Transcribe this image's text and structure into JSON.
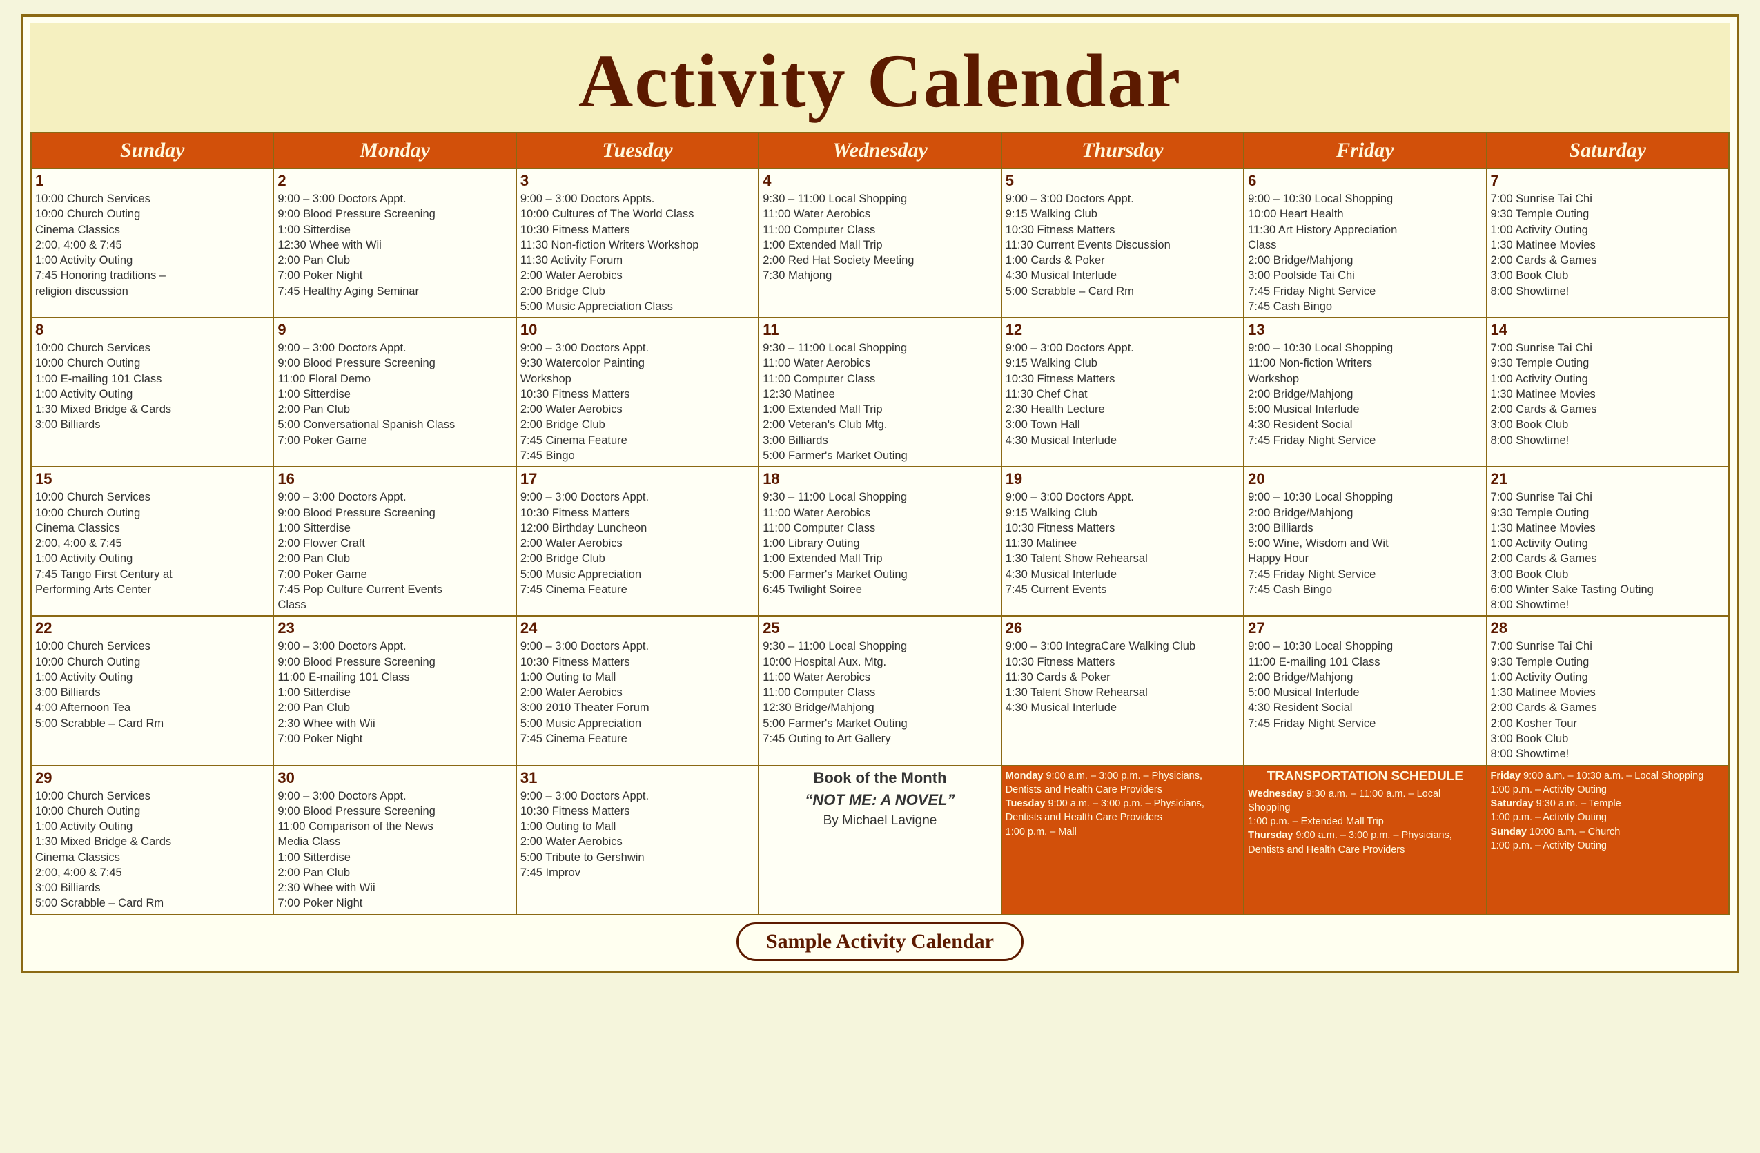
{
  "header": {
    "title": "Activity Calendar"
  },
  "days": [
    "Sunday",
    "Monday",
    "Tuesday",
    "Wednesday",
    "Thursday",
    "Friday",
    "Saturday"
  ],
  "weeks": [
    {
      "cells": [
        {
          "num": "1",
          "events": [
            "10:00 Church Services",
            "10:00 Church Outing",
            "Cinema Classics",
            "2:00, 4:00 & 7:45",
            "1:00  Activity Outing",
            "7:45 Honoring traditions –",
            "religion discussion"
          ]
        },
        {
          "num": "2",
          "events": [
            "9:00 – 3:00 Doctors Appt.",
            "9:00 Blood Pressure Screening",
            "1:00 Sitterdise",
            "12:30 Whee with Wii",
            "2:00 Pan Club",
            "7:00 Poker Night",
            "7:45 Healthy Aging Seminar"
          ]
        },
        {
          "num": "3",
          "events": [
            "9:00 – 3:00 Doctors Appts.",
            "10:00 Cultures of The World Class",
            "10:30 Fitness Matters",
            "11:30 Non-fiction Writers Workshop",
            "11:30 Activity Forum",
            "2:00 Water Aerobics",
            "2:00 Bridge Club",
            "5:00 Music Appreciation Class"
          ]
        },
        {
          "num": "4",
          "events": [
            "9:30 – 11:00 Local Shopping",
            "11:00 Water Aerobics",
            "11:00 Computer Class",
            "1:00 Extended Mall Trip",
            "2:00 Red Hat Society Meeting",
            "7:30 Mahjong"
          ]
        },
        {
          "num": "5",
          "events": [
            "9:00 – 3:00 Doctors Appt.",
            "9:15 Walking Club",
            "10:30 Fitness Matters",
            "11:30 Current Events Discussion",
            "1:00 Cards & Poker",
            "4:30 Musical Interlude",
            "5:00 Scrabble – Card Rm"
          ]
        },
        {
          "num": "6",
          "events": [
            "9:00 – 10:30 Local Shopping",
            "10:00 Heart Health",
            "11:30 Art History Appreciation",
            "Class",
            "2:00 Bridge/Mahjong",
            "3:00 Poolside Tai Chi",
            "7:45 Friday Night Service",
            "7:45 Cash Bingo"
          ]
        },
        {
          "num": "7",
          "events": [
            "7:00 Sunrise Tai Chi",
            "9:30 Temple Outing",
            "1:00  Activity Outing",
            "1:30 Matinee Movies",
            "2:00 Cards & Games",
            "3:00 Book Club",
            "8:00 Showtime!"
          ]
        }
      ]
    },
    {
      "cells": [
        {
          "num": "8",
          "events": [
            "10:00 Church Services",
            "10:00 Church Outing",
            "1:00 E-mailing 101 Class",
            "1:00  Activity Outing",
            "1:30 Mixed Bridge & Cards",
            "3:00 Billiards"
          ]
        },
        {
          "num": "9",
          "events": [
            "9:00 – 3:00 Doctors Appt.",
            "9:00 Blood Pressure Screening",
            "11:00 Floral Demo",
            "1:00 Sitterdise",
            "2:00 Pan Club",
            "5:00 Conversational Spanish Class",
            "7:00 Poker Game"
          ]
        },
        {
          "num": "10",
          "events": [
            "9:00 – 3:00 Doctors Appt.",
            "9:30 Watercolor Painting",
            "Workshop",
            "10:30 Fitness Matters",
            "2:00 Water Aerobics",
            "2:00 Bridge Club",
            "7:45 Cinema Feature",
            "7:45 Bingo"
          ]
        },
        {
          "num": "11",
          "events": [
            "9:30 – 11:00 Local Shopping",
            "11:00 Water Aerobics",
            "11:00 Computer Class",
            "12:30 Matinee",
            "1:00 Extended Mall Trip",
            "2:00 Veteran's Club Mtg.",
            "3:00 Billiards",
            "5:00 Farmer's Market Outing"
          ]
        },
        {
          "num": "12",
          "events": [
            "9:00 – 3:00 Doctors Appt.",
            "9:15 Walking Club",
            "10:30 Fitness Matters",
            "11:30 Chef Chat",
            "2:30 Health Lecture",
            "3:00 Town Hall",
            "4:30 Musical Interlude"
          ]
        },
        {
          "num": "13",
          "events": [
            "9:00 – 10:30 Local Shopping",
            "11:00 Non-fiction Writers",
            "Workshop",
            "2:00 Bridge/Mahjong",
            "5:00 Musical Interlude",
            "4:30 Resident Social",
            "7:45 Friday Night Service"
          ]
        },
        {
          "num": "14",
          "events": [
            "7:00 Sunrise Tai Chi",
            "9:30 Temple Outing",
            "1:00  Activity Outing",
            "1:30 Matinee Movies",
            "2:00 Cards & Games",
            "3:00 Book Club",
            "8:00 Showtime!"
          ]
        }
      ]
    },
    {
      "cells": [
        {
          "num": "15",
          "events": [
            "10:00 Church Services",
            "10:00 Church Outing",
            "Cinema Classics",
            "2:00, 4:00 & 7:45",
            "1:00  Activity Outing",
            "7:45 Tango First Century at",
            "Performing Arts Center"
          ]
        },
        {
          "num": "16",
          "events": [
            "9:00 – 3:00 Doctors Appt.",
            "9:00 Blood Pressure Screening",
            "1:00 Sitterdise",
            "2:00 Flower Craft",
            "2:00 Pan Club",
            "7:00 Poker Game",
            "7:45 Pop Culture Current Events",
            "Class"
          ]
        },
        {
          "num": "17",
          "events": [
            "9:00 – 3:00 Doctors Appt.",
            "10:30 Fitness Matters",
            "12:00 Birthday Luncheon",
            "2:00 Water Aerobics",
            "2:00 Bridge Club",
            "5:00 Music Appreciation",
            "7:45 Cinema Feature"
          ]
        },
        {
          "num": "18",
          "events": [
            "9:30 – 11:00 Local Shopping",
            "11:00 Water Aerobics",
            "11:00 Computer Class",
            "1:00 Library Outing",
            "1:00 Extended Mall Trip",
            "5:00 Farmer's Market Outing",
            "6:45 Twilight Soiree"
          ]
        },
        {
          "num": "19",
          "events": [
            "9:00 – 3:00 Doctors Appt.",
            "9:15 Walking Club",
            "10:30 Fitness Matters",
            "11:30 Matinee",
            "1:30 Talent Show Rehearsal",
            "4:30 Musical Interlude",
            "7:45 Current Events"
          ]
        },
        {
          "num": "20",
          "events": [
            "9:00 – 10:30 Local Shopping",
            "2:00 Bridge/Mahjong",
            "3:00 Billiards",
            "5:00 Wine, Wisdom and Wit",
            "Happy Hour",
            "7:45 Friday Night Service",
            "7:45 Cash Bingo"
          ]
        },
        {
          "num": "21",
          "events": [
            "7:00 Sunrise Tai Chi",
            "9:30 Temple Outing",
            "1:30 Matinee Movies",
            "1:00  Activity Outing",
            "2:00 Cards & Games",
            "3:00 Book Club",
            "6:00 Winter Sake Tasting Outing",
            "8:00 Showtime!"
          ]
        }
      ]
    },
    {
      "cells": [
        {
          "num": "22",
          "events": [
            "10:00 Church Services",
            "10:00 Church Outing",
            "1:00  Activity Outing",
            "3:00 Billiards",
            "4:00 Afternoon Tea",
            "5:00 Scrabble – Card Rm"
          ]
        },
        {
          "num": "23",
          "events": [
            "9:00 – 3:00 Doctors Appt.",
            "9:00 Blood Pressure Screening",
            "11:00 E-mailing 101 Class",
            "1:00 Sitterdise",
            "2:00 Pan Club",
            "2:30 Whee with Wii",
            "7:00 Poker Night"
          ]
        },
        {
          "num": "24",
          "events": [
            "9:00 – 3:00 Doctors Appt.",
            "10:30 Fitness Matters",
            "1:00 Outing to Mall",
            "2:00 Water Aerobics",
            "3:00 2010 Theater Forum",
            "5:00 Music Appreciation",
            "7:45 Cinema Feature"
          ]
        },
        {
          "num": "25",
          "events": [
            "9:30 – 11:00 Local Shopping",
            "10:00 Hospital Aux. Mtg.",
            "11:00 Water Aerobics",
            "11:00 Computer Class",
            "12:30 Bridge/Mahjong",
            "5:00 Farmer's Market Outing",
            "7:45 Outing to Art Gallery"
          ]
        },
        {
          "num": "26",
          "events": [
            "9:00 – 3:00 IntegraCare Walking Club",
            "10:30 Fitness Matters",
            "11:30 Cards & Poker",
            "1:30 Talent Show Rehearsal",
            "4:30 Musical Interlude"
          ]
        },
        {
          "num": "27",
          "events": [
            "9:00 – 10:30 Local Shopping",
            "11:00 E-mailing 101 Class",
            "2:00 Bridge/Mahjong",
            "5:00 Musical Interlude",
            "4:30 Resident Social",
            "7:45 Friday Night Service"
          ]
        },
        {
          "num": "28",
          "events": [
            "7:00 Sunrise Tai Chi",
            "9:30 Temple Outing",
            "1:00  Activity Outing",
            "1:30 Matinee Movies",
            "2:00 Cards & Games",
            "2:00 Kosher Tour",
            "3:00 Book Club",
            "8:00 Showtime!"
          ]
        }
      ]
    },
    {
      "cells": [
        {
          "num": "29",
          "events": [
            "10:00 Church Services",
            "10:00 Church Outing",
            "1:00  Activity Outing",
            "1:30 Mixed Bridge & Cards",
            "Cinema Classics",
            "2:00, 4:00 & 7:45",
            "3:00 Billiards",
            "5:00 Scrabble – Card Rm"
          ]
        },
        {
          "num": "30",
          "events": [
            "9:00 – 3:00 Doctors Appt.",
            "9:00 Blood Pressure Screening",
            "11:00 Comparison of the News",
            "Media Class",
            "1:00 Sitterdise",
            "2:00 Pan Club",
            "2:30 Whee with Wii",
            "7:00 Poker Night"
          ]
        },
        {
          "num": "31",
          "events": [
            "9:00 – 3:00 Doctors Appt.",
            "10:30 Fitness Matters",
            "1:00 Outing to Mall",
            "2:00 Water Aerobics",
            "5:00 Tribute to Gershwin",
            "7:45 Improv"
          ]
        },
        {
          "type": "book",
          "title": "Book of the Month",
          "subtitle": "“NOT ME: A NOVEL”",
          "author": "By Michael Lavigne"
        },
        {
          "type": "transport-multi",
          "sections": [
            {
              "day": "Monday",
              "text": "9:00 a.m. – 3:00 p.m. – Physicians, Dentists and Health Care Providers"
            },
            {
              "day": "Tuesday",
              "text": "9:00 a.m. – 3:00 p.m. – Physicians, Dentists and Health Care Providers"
            },
            {
              "day": "",
              "text": "1:00 p.m. – Mall"
            }
          ]
        },
        {
          "type": "transport-multi",
          "title": "TRANSPORTATION SCHEDULE",
          "sections": [
            {
              "day": "Wednesday",
              "text": "9:30 a.m. – 11:00 a.m. – Local Shopping"
            },
            {
              "day": "",
              "text": "1:00 p.m. – Extended Mall Trip"
            },
            {
              "day": "Thursday",
              "text": "9:00 a.m. – 3:00 p.m. – Physicians, Dentists and Health Care Providers"
            }
          ]
        },
        {
          "type": "transport-multi",
          "sections": [
            {
              "day": "Friday",
              "text": "9:00 a.m. – 10:30 a.m. – Local Shopping"
            },
            {
              "day": "",
              "text": "1:00 p.m. – Activity Outing"
            },
            {
              "day": "Saturday",
              "text": "9:30 a.m. – Temple"
            },
            {
              "day": "",
              "text": "1:00 p.m. – Activity Outing"
            },
            {
              "day": "Sunday",
              "text": "10:00 a.m. – Church"
            },
            {
              "day": "",
              "text": "1:00 p.m. – Activity Outing"
            }
          ]
        }
      ]
    }
  ],
  "footer": {
    "badge": "Sample Activity Calendar"
  }
}
